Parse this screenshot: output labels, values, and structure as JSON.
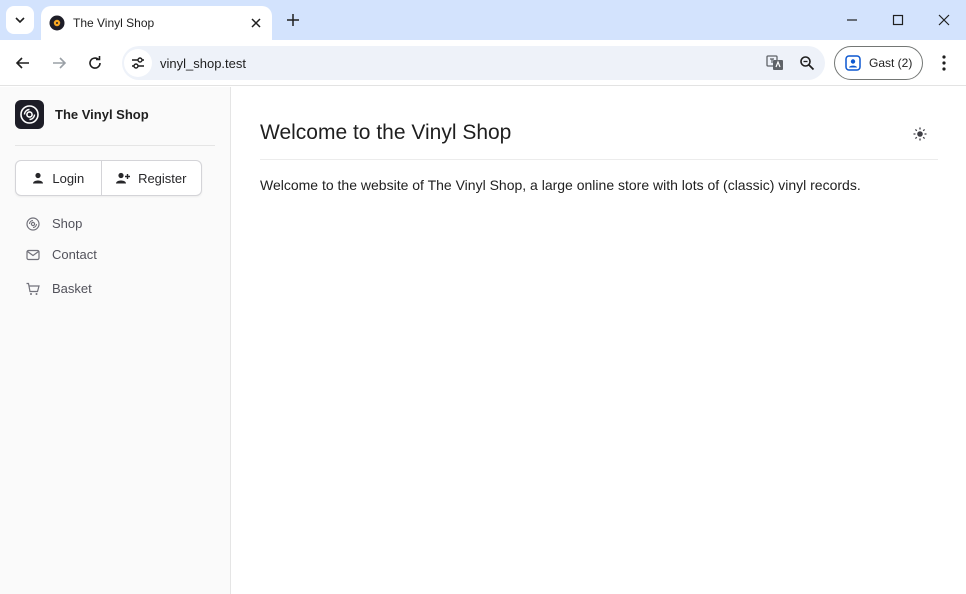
{
  "browser": {
    "tab_title": "The Vinyl Shop",
    "url": "vinyl_shop.test",
    "profile_label": "Gast (2)",
    "icons": [
      "tab-search-icon",
      "vinyl-favicon-icon",
      "close-icon",
      "plus-icon",
      "minimize-icon",
      "maximize-icon",
      "window-close-icon",
      "back-icon",
      "forward-icon",
      "reload-icon",
      "site-info-icon",
      "translate-icon",
      "zoom-icon",
      "profile-icon",
      "more-vert-icon"
    ]
  },
  "sidebar": {
    "brand_name": "The Vinyl Shop",
    "login_label": "Login",
    "register_label": "Register",
    "items": [
      {
        "label": "Shop",
        "icon": "vinyl-icon"
      },
      {
        "label": "Contact",
        "icon": "mail-icon"
      },
      {
        "label": "Basket",
        "icon": "cart-icon"
      }
    ]
  },
  "main": {
    "title": "Welcome to the Vinyl Shop",
    "intro": "Welcome to the website of The Vinyl Shop, a large online store with lots of (classic) vinyl records.",
    "theme_icon": "sun-icon"
  },
  "colors": {
    "tabbar": "#d3e3fd",
    "omnibox": "#eef2f9",
    "sidebar_bg": "#fafafa",
    "logo_bg": "#1d1d27",
    "text": "#1f1f1f",
    "muted": "#52525b"
  }
}
